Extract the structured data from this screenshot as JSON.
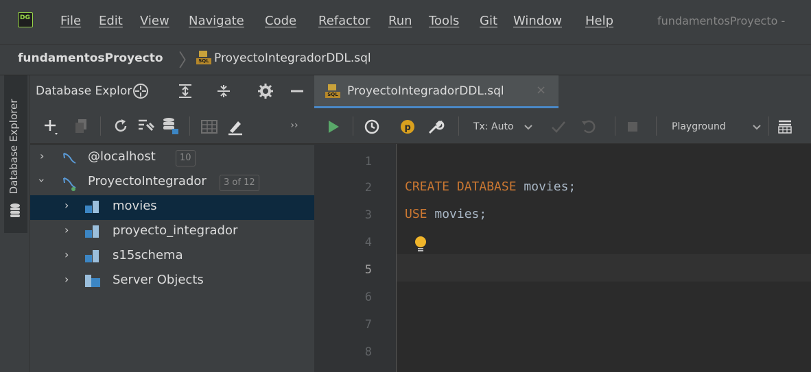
{
  "menubar": {
    "logo_text": "DG",
    "items": [
      "File",
      "Edit",
      "View",
      "Navigate",
      "Code",
      "Refactor",
      "Run",
      "Tools",
      "Git",
      "Window",
      "Help"
    ],
    "window_title": "fundamentosProyecto -"
  },
  "breadcrumb": {
    "project": "fundamentosProyecto",
    "file": "ProyectoIntegradorDDL.sql"
  },
  "tool_strip": {
    "label": "Database Explorer"
  },
  "explorer": {
    "title": "Database Explor",
    "tree": [
      {
        "label": "@localhost",
        "badge": "10",
        "level": 0,
        "expanded": false
      },
      {
        "label": "ProyectoIntegrador",
        "badge": "3 of 12",
        "level": 0,
        "expanded": true
      },
      {
        "label": "movies",
        "level": 1,
        "expanded": false,
        "selected": true
      },
      {
        "label": "proyecto_integrador",
        "level": 1,
        "expanded": false
      },
      {
        "label": "s15schema",
        "level": 1,
        "expanded": false
      },
      {
        "label": "Server Objects",
        "level": 1,
        "expanded": false
      }
    ]
  },
  "editor": {
    "tab_label": "ProyectoIntegradorDDL.sql",
    "icon_label": "SQL",
    "tx_mode": "Tx: Auto",
    "session": "Playground",
    "line_numbers": [
      "1",
      "2",
      "3",
      "4",
      "5",
      "6",
      "7",
      "8"
    ],
    "current_line": 5,
    "code": {
      "line2_kw": "CREATE DATABASE",
      "line2_id": "movies;",
      "line3_kw": "USE",
      "line3_id": "movies;"
    }
  },
  "colors": {
    "keyword": "#cc7832",
    "identifier": "#a9b7c6",
    "selection": "#0d293e",
    "accent": "#4a88c7",
    "run": "#59a869"
  }
}
